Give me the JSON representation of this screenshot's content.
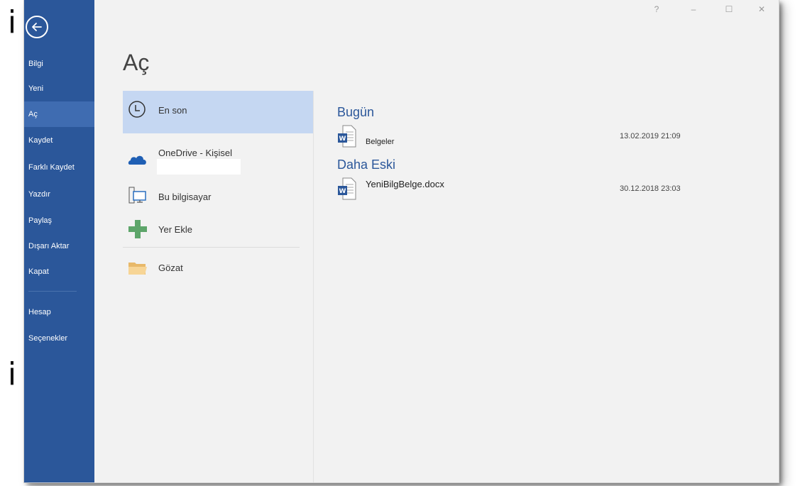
{
  "background_letters": {
    "top": "i",
    "bottom": "i"
  },
  "sidebar": {
    "items": [
      {
        "label": "Bilgi",
        "active": false
      },
      {
        "label": "Yeni",
        "active": false
      },
      {
        "label": "Aç",
        "active": true
      },
      {
        "label": "Kaydet",
        "active": false
      },
      {
        "label": "Farklı Kaydet",
        "active": false
      },
      {
        "label": "Yazdır",
        "active": false
      },
      {
        "label": "Paylaş",
        "active": false
      },
      {
        "label": "Dışarı Aktar",
        "active": false
      },
      {
        "label": "Kapat",
        "active": false
      }
    ],
    "footer_items": [
      {
        "label": "Hesap"
      },
      {
        "label": "Seçenekler"
      }
    ]
  },
  "title_bar": {
    "help": "?",
    "minimize": "–",
    "maximize": "☐",
    "close": "✕"
  },
  "page_title": "Aç",
  "places": {
    "recent": "En son",
    "onedrive": "OneDrive - Kişisel",
    "this_pc": "Bu bilgisayar",
    "add_place": "Yer Ekle",
    "browse": "Gözat"
  },
  "recent": {
    "groups": [
      {
        "heading": "Bugün",
        "files": [
          {
            "name": "Belgeler",
            "date": "13.02.2019 21:09"
          }
        ]
      },
      {
        "heading": "Daha Eski",
        "files": [
          {
            "name": "YeniBilgBelge.docx",
            "date": "30.12.2018 23:03"
          }
        ]
      }
    ]
  },
  "colors": {
    "accent": "#2b579a",
    "selected": "#c5d7f2",
    "sidebar_active": "#3f6cb1"
  }
}
